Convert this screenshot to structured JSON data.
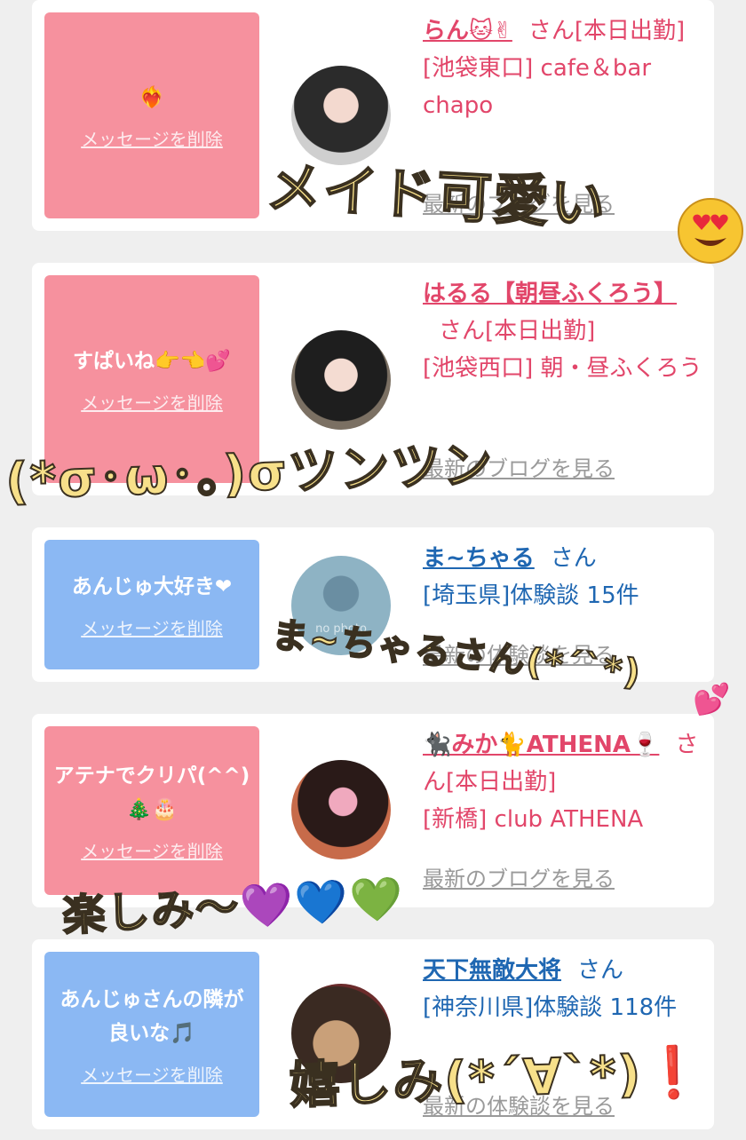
{
  "cards": [
    {
      "message": "❤️‍🔥",
      "delete_label": "メッセージを削除",
      "name": "らん🐱✌",
      "suffix": "さん[本日出勤]",
      "location": "[池袋東口] cafe＆bar chapo",
      "link": "最新のブログを見る"
    },
    {
      "message": "すぱいね👉👈💕",
      "delete_label": "メッセージを削除",
      "name": "はるる【朝昼ふくろう】",
      "suffix": "さん[本日出勤]",
      "location": "[池袋西口] 朝・昼ふくろう",
      "link": "最新のブログを見る"
    },
    {
      "message": "あんじゅ大好き❤",
      "delete_label": "メッセージを削除",
      "name": "ま~ちゃる",
      "suffix": "さん",
      "location": "[埼玉県]体験談 15件",
      "avatar_text": "no photo",
      "link": "最新の体験談を見る"
    },
    {
      "message": "アテナでクリパ(^^)🎄🎂",
      "delete_label": "メッセージを削除",
      "name": "🐈‍⬛みか🐈ATHENA🍷",
      "suffix": "さん[本日出勤]",
      "location": "[新橋] club ATHENA",
      "link": "最新のブログを見る"
    },
    {
      "message": "あんじゅさんの隣が良いな🎵",
      "delete_label": "メッセージを削除",
      "name": "天下無敵大将",
      "suffix": "さん",
      "location": "[神奈川県]体験談 118件",
      "link": "最新の体験談を見る"
    }
  ],
  "overlays": {
    "t1": "メイド可愛い",
    "t2": "(*σ･ω･。)σツンツン",
    "t3": "ま~ちゃるさん(*´`*)",
    "t4": "楽しみ〜💜💙💚",
    "t5": "嬉しみ(*´∀`*)❗"
  },
  "colors": {
    "pink_bubble": "#f6919e",
    "blue_bubble": "#8bb8f3",
    "pink_text": "#e2466a",
    "blue_text": "#1f67b2"
  }
}
